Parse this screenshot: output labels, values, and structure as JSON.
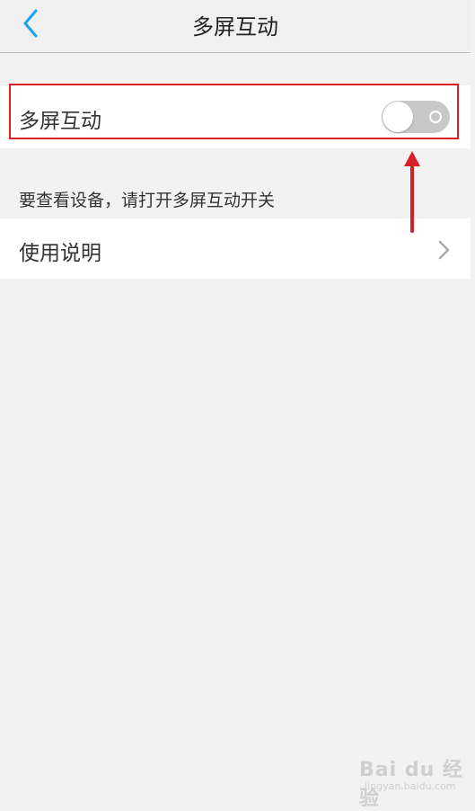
{
  "header": {
    "title": "多屏互动",
    "back_icon": "chevron-left-icon"
  },
  "settings": {
    "toggle_row": {
      "label": "多屏互动",
      "enabled": false
    },
    "hint": "要查看设备，请打开多屏互动开关",
    "help_row": {
      "label": "使用说明",
      "icon": "chevron-right-icon"
    }
  },
  "annotation": {
    "highlight_color": "#e02020",
    "arrow_color": "#d61f26"
  },
  "colors": {
    "accent": "#1aa3f0",
    "background": "#f2f2f2",
    "toggle_off": "#c8c8c8"
  },
  "watermark": {
    "text": "Bai du 经验",
    "url": "jingyan.baidu.com"
  }
}
